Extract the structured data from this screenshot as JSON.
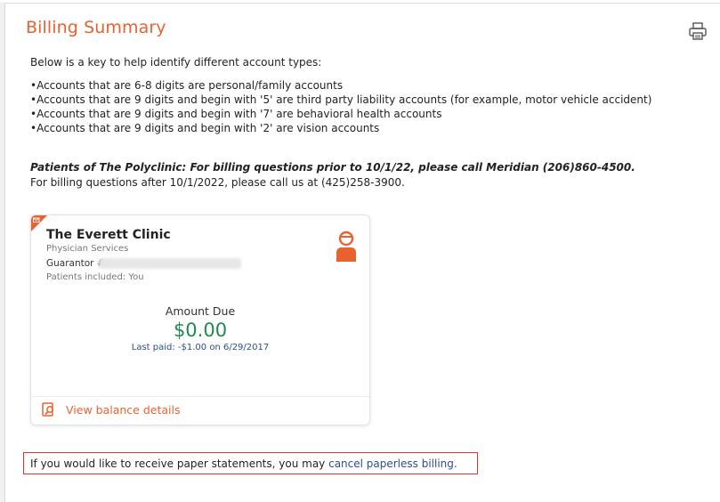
{
  "header": {
    "title": "Billing Summary",
    "print_icon": "printer-icon"
  },
  "key": {
    "intro": "Below is a key to help identify different account types:",
    "items": [
      "•Accounts that are 6-8 digits are personal/family accounts",
      "•Accounts that are 9 digits and begin with '5' are third party liability accounts (for example, motor vehicle accident)",
      "•Accounts that are 9 digits and begin with '7' are behavioral health accounts",
      "•Accounts that are 9 digits and begin with '2' are vision accounts"
    ]
  },
  "notice": {
    "bold": "Patients of The Polyclinic: For billing questions prior to 10/1/22, please call Meridian (206)860-4500.",
    "plain": "For billing questions after 10/1/2022, please call us at (425)258-3900."
  },
  "account_card": {
    "clinic": "The Everett Clinic",
    "service": "Physician Services",
    "guarantor_label": "Guarantor #",
    "patients": "Patients included: You",
    "amount_label": "Amount Due",
    "amount": "$0.00",
    "last_paid": "Last paid: -$1.00 on 6/29/2017",
    "view_link": "View balance details",
    "icons": {
      "corner": "paperless-envelope-icon",
      "avatar": "user-avatar-icon",
      "view": "magnifier-document-icon"
    }
  },
  "paperless": {
    "text": "If you would like to receive paper statements, you may ",
    "link": "cancel paperless billing."
  },
  "colors": {
    "accent_orange": "#e8622f",
    "amount_green": "#1f8a52",
    "link_blue": "#2b4e8c",
    "highlight_red": "#d9342b"
  }
}
